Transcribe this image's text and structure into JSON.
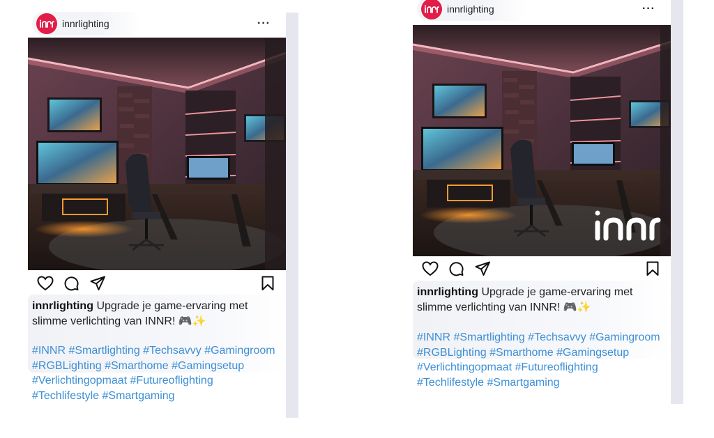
{
  "posts": [
    {
      "username": "innrlighting",
      "more_label": "···",
      "caption_user": "innrlighting",
      "caption_line1": "Upgrade je game-ervaring met",
      "caption_line2": "slimme verlichting van INNR! 🎮✨",
      "hashtag_lines": [
        "#INNR #Smartlighting #Techsavvy #Gamingroom",
        "#RGBLighting #Smarthome #Gamingsetup",
        "#Verlichtingopmaat #Futureoflighting",
        "#Techlifestyle #Smartgaming"
      ],
      "watermark": ""
    },
    {
      "username": "innrlighting",
      "more_label": "···",
      "caption_user": "innrlighting",
      "caption_line1": "Upgrade je game-ervaring met",
      "caption_line2": "slimme verlichting van INNR! 🎮✨",
      "hashtag_lines": [
        "#INNR #Smartlighting #Techsavvy #Gamingroom",
        "#RGBLighting #Smarthome #Gamingsetup",
        "#Verlichtingopmaat #Futureoflighting",
        "#Techlifestyle #Smartgaming"
      ],
      "watermark": "innr"
    }
  ],
  "icons": {
    "like": "heart-icon",
    "comment": "comment-icon",
    "share": "send-icon",
    "save": "bookmark-icon"
  },
  "colors": {
    "brand": "#e11d48",
    "hashtag": "#3d8fd6",
    "glow": "#ff9fa8",
    "warm_led": "#ff9b2f"
  }
}
